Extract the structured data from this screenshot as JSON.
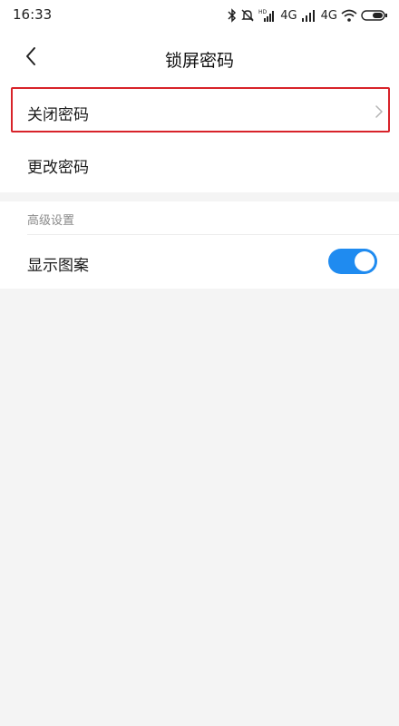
{
  "status_bar": {
    "time": "16:33",
    "icons": [
      "bluetooth-icon",
      "mute-icon",
      "hd-signal-icon",
      "signal-icon",
      "wifi-icon",
      "battery-icon"
    ],
    "net_labels": [
      "4G",
      "4G"
    ]
  },
  "header": {
    "title": "锁屏密码",
    "back_icon": "chevron-left-icon"
  },
  "settings": {
    "items": [
      {
        "label": "关闭密码",
        "has_chevron": true,
        "highlighted": true
      },
      {
        "label": "更改密码",
        "has_chevron": false
      }
    ]
  },
  "advanced": {
    "section_label": "高级设置",
    "show_pattern_label": "显示图案",
    "show_pattern_enabled": true
  },
  "colors": {
    "accent": "#1f8bf0",
    "highlight_border": "#d8232a",
    "background": "#f4f4f4"
  }
}
